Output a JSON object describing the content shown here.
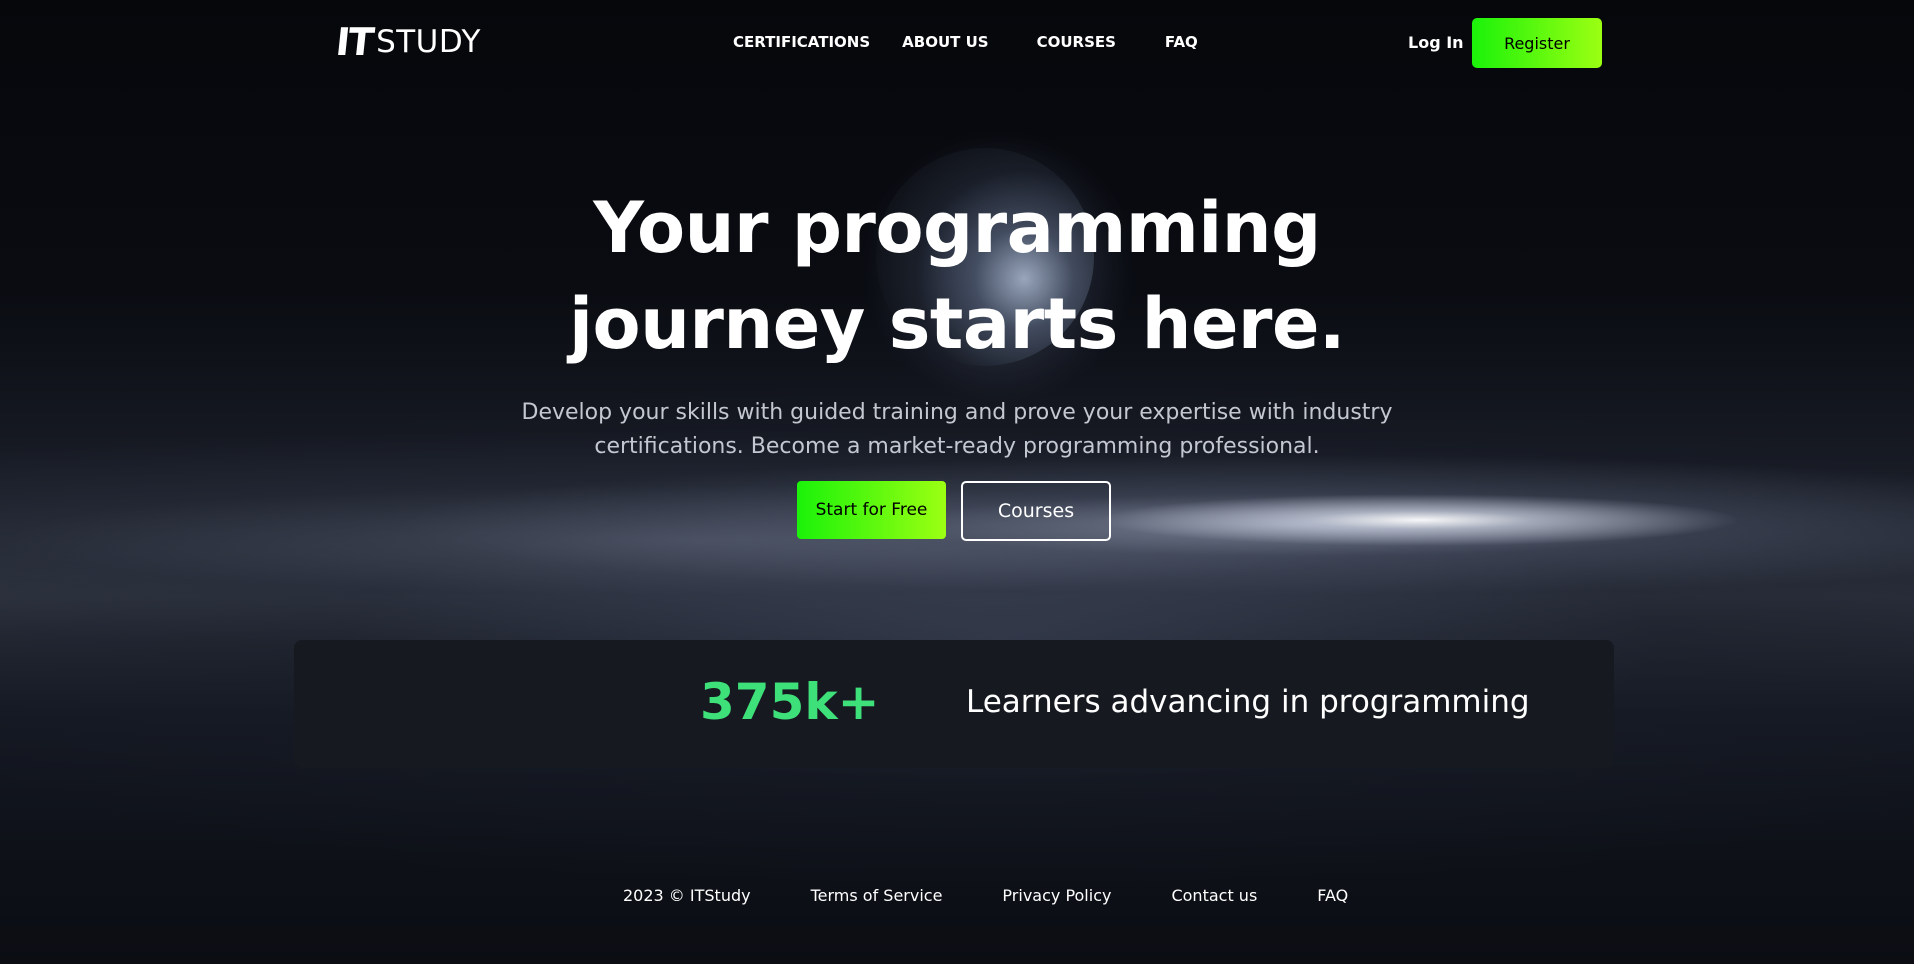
{
  "nav": {
    "logo_mark": "IT",
    "logo_text": "STUDY",
    "links": [
      {
        "label": "CERTIFICATIONS"
      },
      {
        "label": "ABOUT US"
      },
      {
        "label": "COURSES"
      },
      {
        "label": "FAQ"
      }
    ],
    "login_label": "Log In",
    "register_label": "Register"
  },
  "hero": {
    "title_line1": "Your programming",
    "title_line2": "journey starts here.",
    "subtitle_line1": "Develop your skills with guided training and prove your expertise with industry",
    "subtitle_line2": "certifications. Become a market-ready programming professional.",
    "primary_button": "Start for Free",
    "secondary_button": "Courses"
  },
  "stats": {
    "number": "375k+",
    "label": "Learners advancing in programming"
  },
  "footer": {
    "copyright": "2023 © ITStudy",
    "terms": "Terms of Service",
    "privacy": "Privacy Policy",
    "contact": "Contact us",
    "faq": "FAQ"
  },
  "colors": {
    "accent_green_start": "#1bf20a",
    "accent_green_end": "#9cff12",
    "stat_green": "#3ee07a",
    "stats_band": "#171921",
    "background": "#06080d"
  }
}
